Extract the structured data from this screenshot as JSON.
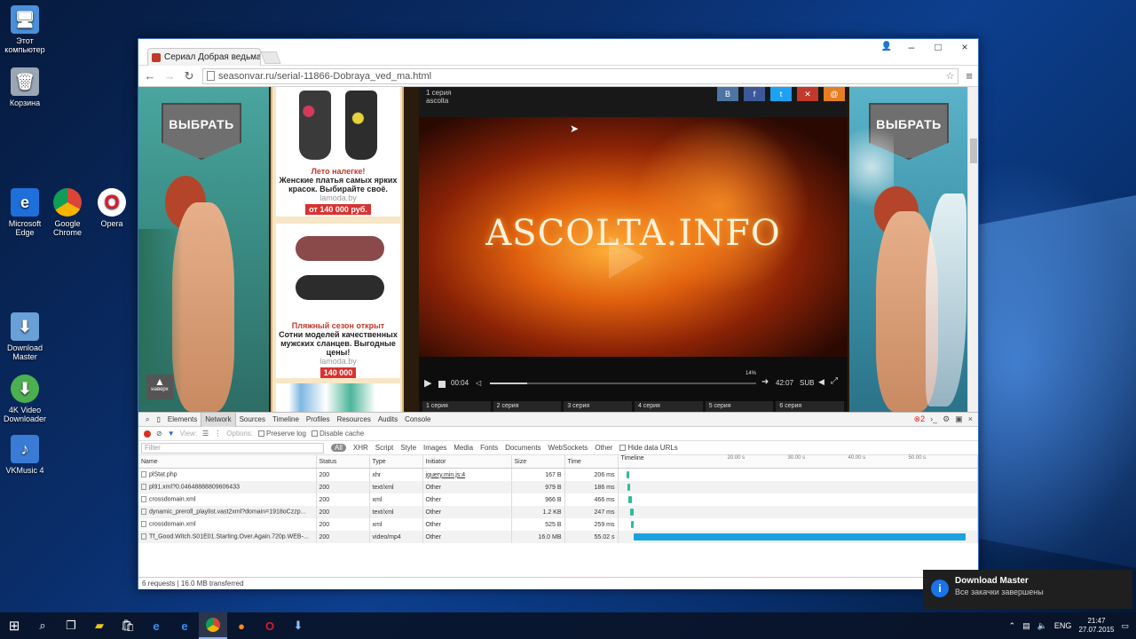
{
  "desktop": {
    "icons": [
      {
        "label": "Этот\nкомпьютер",
        "icon": "computer-icon"
      },
      {
        "label": "Корзина",
        "icon": "recycle-bin-icon"
      },
      {
        "label": "Microsoft Edge",
        "icon": "edge-icon"
      },
      {
        "label": "Google Chrome",
        "icon": "chrome-icon"
      },
      {
        "label": "Opera",
        "icon": "opera-icon"
      },
      {
        "label": "Download Master",
        "icon": "download-master-icon"
      },
      {
        "label": "4K Video Downloader",
        "icon": "4k-video-downloader-icon"
      },
      {
        "label": "VKMusic 4",
        "icon": "vkmusic-icon"
      }
    ]
  },
  "browser": {
    "tab_title": "Сериал Добрая ведьма (",
    "tab_close": "×",
    "window_controls": {
      "minimize": "–",
      "maximize": "□",
      "close": "×"
    },
    "url": "seasonvar.ru/serial-11866-Dobraya_ved_ma.html"
  },
  "page": {
    "banner_button": "ВЫБРАТЬ",
    "scroll_up_label": "наверх",
    "ads": [
      {
        "headline": "Лето налегке!",
        "desc": "Женские платья самых ярких красок. Выбирайте своё.",
        "source": "lamoda.by",
        "price": "от 140 000 руб."
      },
      {
        "headline": "Пляжный сезон открыт",
        "desc": "Сотни моделей качественных мужских сланцев. Выгодные цены!",
        "source": "lamoda.by",
        "price": "140 000"
      }
    ],
    "player": {
      "episode_label": "1 серия",
      "author": "ascolta",
      "share_buttons": [
        "В",
        "f",
        "t",
        "✕",
        "@"
      ],
      "video_logo": "ASCOLTA.INFO",
      "time_current": "00:04",
      "time_total": "42:07",
      "progress_percent": 14,
      "progress_label": "14%",
      "subtitle_label": "SUB",
      "episodes": [
        "1 серия",
        "2 серия",
        "3 серия",
        "4 серия",
        "5 серия",
        "6 серия"
      ]
    }
  },
  "devtools": {
    "tabs": [
      "Elements",
      "Network",
      "Sources",
      "Timeline",
      "Profiles",
      "Resources",
      "Audits",
      "Console"
    ],
    "active_tab": "Network",
    "error_count": "2",
    "toolbar": {
      "view_label": "View:",
      "options_label": "Options:",
      "preserve_log": "Preserve log",
      "disable_cache": "Disable cache"
    },
    "filter": {
      "placeholder": "Filter",
      "types": [
        "All",
        "XHR",
        "Script",
        "Style",
        "Images",
        "Media",
        "Fonts",
        "Documents",
        "WebSockets",
        "Other"
      ],
      "hide_data_urls": "Hide data URLs"
    },
    "columns": [
      "Name",
      "Status",
      "Type",
      "Initiator",
      "Size",
      "Time",
      "Timeline"
    ],
    "timeline_ticks": [
      "20.00 s",
      "30.00 s",
      "40.00 s",
      "50.00 s"
    ],
    "rows": [
      {
        "name": "plStat.php",
        "status": "200",
        "type": "xhr",
        "initiator": "jquery.min.js:4",
        "size": "167 B",
        "time": "206 ms"
      },
      {
        "name": "pl91.xml?0.04648888809606433",
        "status": "200",
        "type": "text/xml",
        "initiator": "Other",
        "size": "979 B",
        "time": "186 ms"
      },
      {
        "name": "crossdomain.xml",
        "status": "200",
        "type": "xml",
        "initiator": "Other",
        "size": "966 B",
        "time": "466 ms"
      },
      {
        "name": "dynamic_preroll_playlist.vast2xml?domain=1918oCzzp...",
        "status": "200",
        "type": "text/xml",
        "initiator": "Other",
        "size": "1.2 KB",
        "time": "247 ms"
      },
      {
        "name": "crossdomain.xml",
        "status": "200",
        "type": "xml",
        "initiator": "Other",
        "size": "525 B",
        "time": "259 ms"
      },
      {
        "name": "Tf_Good.Witch.S01E01.Starting.Over.Again.720p.WEB-...",
        "status": "200",
        "type": "video/mp4",
        "initiator": "Other",
        "size": "16.0 MB",
        "time": "55.02 s"
      }
    ],
    "status_bar": "6 requests  |  16.0 MB transferred"
  },
  "notification": {
    "title": "Download Master",
    "body": "Все закачки завершены",
    "icon": "info-icon"
  },
  "taskbar": {
    "items": [
      "start-icon",
      "search-icon",
      "task-view-icon",
      "file-explorer-icon",
      "store-icon",
      "edge-icon",
      "edge-icon",
      "chrome-icon",
      "firefox-icon",
      "opera-icon",
      "download-master-icon"
    ],
    "language": "ENG",
    "time": "21:47",
    "date": "27.07.2015"
  }
}
